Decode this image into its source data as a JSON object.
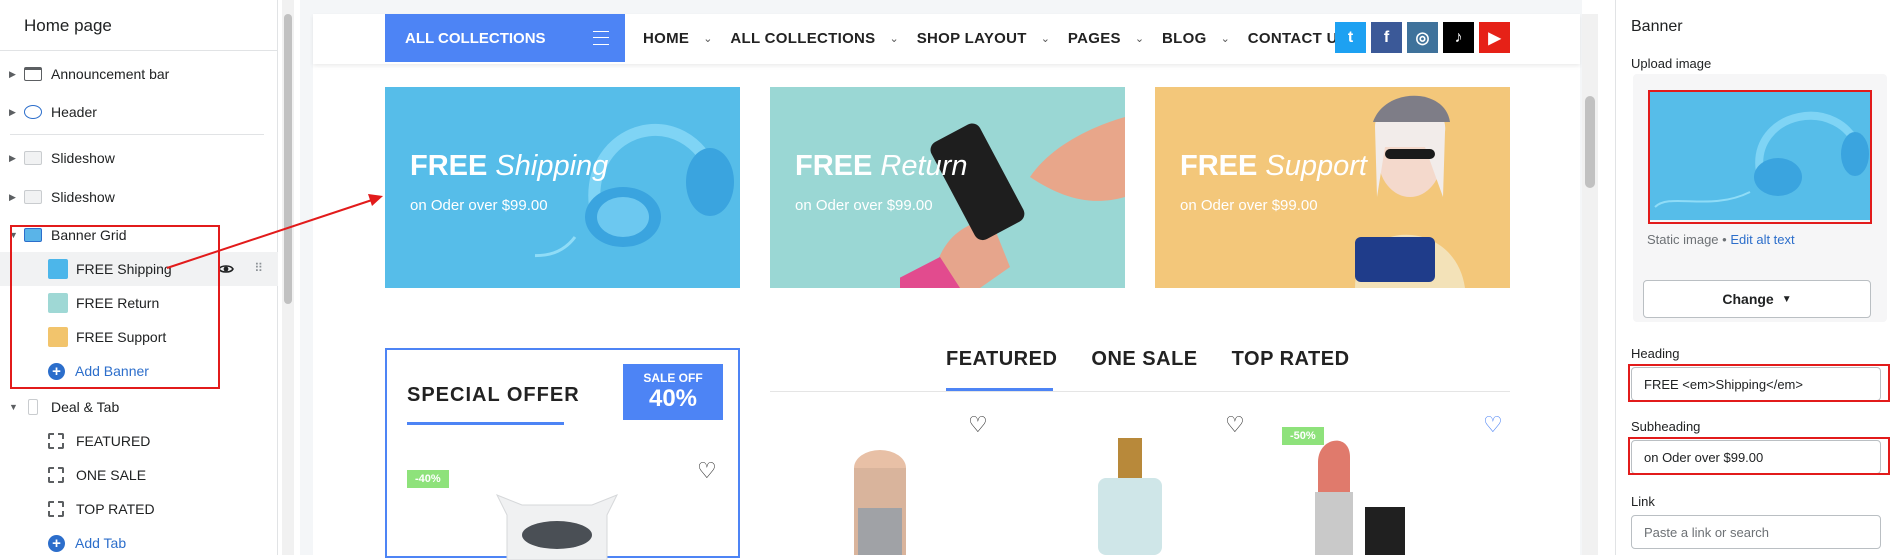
{
  "sidebar": {
    "title": "Home page",
    "sections": [
      {
        "label": "Announcement bar",
        "icon": "announcement-bar-icon"
      },
      {
        "label": "Header",
        "icon": "header-icon"
      },
      {
        "label": "Slideshow",
        "icon": "slideshow-icon"
      },
      {
        "label": "Slideshow",
        "icon": "slideshow-icon"
      },
      {
        "label": "Banner Grid",
        "icon": "banner-grid-icon"
      },
      {
        "label": "Deal & Tab",
        "icon": "deal-tab-icon"
      }
    ],
    "banner_blocks": [
      {
        "label": "FREE Shipping",
        "color": "#4cb6ea"
      },
      {
        "label": "FREE Return",
        "color": "#9fd8d5"
      },
      {
        "label": "FREE Support",
        "color": "#f2c46c"
      }
    ],
    "add_banner": "Add Banner",
    "tab_blocks": [
      "FEATURED",
      "ONE SALE",
      "TOP RATED"
    ],
    "add_tab": "Add Tab"
  },
  "store": {
    "all_collections": "ALL COLLECTIONS",
    "menu": [
      "HOME",
      "ALL COLLECTIONS",
      "SHOP LAYOUT",
      "PAGES",
      "BLOG",
      "CONTACT US"
    ],
    "menu_has_dropdown": [
      true,
      true,
      true,
      true,
      true,
      false
    ],
    "social": [
      {
        "icon": "twitter-icon",
        "glyph": "t",
        "color": "#1da1f2"
      },
      {
        "icon": "facebook-icon",
        "glyph": "f",
        "color": "#3b5998"
      },
      {
        "icon": "instagram-icon",
        "glyph": "◎",
        "color": "#3f729b"
      },
      {
        "icon": "tiktok-icon",
        "glyph": "♪",
        "color": "#000000"
      },
      {
        "icon": "youtube-icon",
        "glyph": "▶",
        "color": "#e62117"
      }
    ],
    "banners": [
      {
        "bold": "FREE",
        "italic": "Shipping",
        "sub": "on Oder over $99.00",
        "color": "#56bde9"
      },
      {
        "bold": "FREE",
        "italic": "Return",
        "sub": "on Oder over $99.00",
        "color": "#9ad7d4"
      },
      {
        "bold": "FREE",
        "italic": "Support",
        "sub": "on Oder over $99.00",
        "color": "#f3c77a"
      }
    ],
    "special": {
      "title": "SPECIAL OFFER",
      "off_label": "SALE OFF",
      "off_value": "40%",
      "tag": "-40%"
    },
    "tabs": [
      "FEATURED",
      "ONE SALE",
      "TOP RATED"
    ],
    "product_tag": "-50%"
  },
  "settings": {
    "title": "Banner",
    "upload_label": "Upload image",
    "static_image": "Static image •",
    "edit_alt": "Edit alt text",
    "change_button": "Change",
    "heading_label": "Heading",
    "heading_value": "FREE <em>Shipping</em>",
    "subheading_label": "Subheading",
    "subheading_value": "on Oder over $99.00",
    "link_label": "Link",
    "link_placeholder": "Paste a link or search"
  }
}
